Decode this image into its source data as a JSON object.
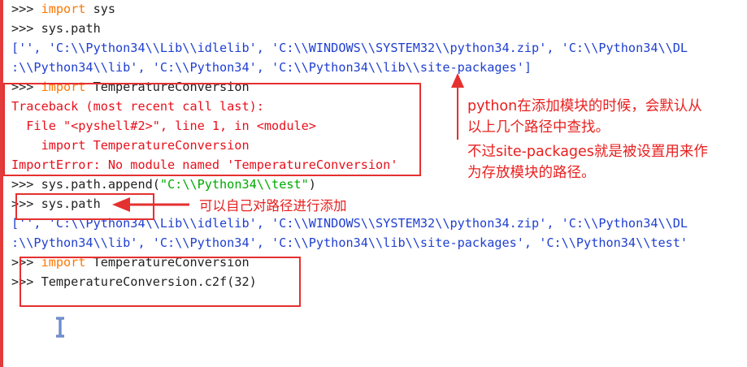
{
  "shell": {
    "lines": [
      {
        "prompt": ">>> ",
        "kw": "import",
        "code": " sys"
      },
      {
        "prompt": ">>> ",
        "code": "sys.path"
      },
      {
        "out": "['', 'C:\\\\Python34\\\\Lib\\\\idlelib', 'C:\\\\WINDOWS\\\\SYSTEM32\\\\python34.zip', 'C:\\\\Python34\\\\DL"
      },
      {
        "out": ":\\\\Python34\\\\lib', 'C:\\\\Python34', 'C:\\\\Python34\\\\lib\\\\site-packages']"
      },
      {
        "prompt": ">>> ",
        "kw": "import",
        "code": " TemperatureConversion"
      },
      {
        "err": "Traceback (most recent call last):"
      },
      {
        "err": "  File \"<pyshell#2>\", line 1, in <module>"
      },
      {
        "err": "    import TemperatureConversion"
      },
      {
        "err": "ImportError: No module named 'TemperatureConversion'"
      },
      {
        "prompt": ">>> ",
        "code": "sys.path.append(",
        "str": "\"C:\\\\Python34\\\\test\"",
        "code2": ")"
      },
      {
        "prompt": ">>> ",
        "code": "sys.path"
      },
      {
        "out": "['', 'C:\\\\Python34\\\\Lib\\\\idlelib', 'C:\\\\WINDOWS\\\\SYSTEM32\\\\python34.zip', 'C:\\\\Python34\\\\DL"
      },
      {
        "out": ":\\\\Python34\\\\lib', 'C:\\\\Python34', 'C:\\\\Python34\\\\lib\\\\site-packages', 'C:\\\\Python34\\\\test'"
      },
      {
        "prompt": ">>> ",
        "kw": "import",
        "code": " TemperatureConversion"
      },
      {
        "prompt": ">>> ",
        "code": "TemperatureConversion.c2f(32)"
      }
    ]
  },
  "annotations": {
    "note_search_line1": "python在添加模块的时候，会默认从",
    "note_search_line2": "以上几个路径中查找。",
    "note_site_line1": "不过site-packages就是被设置用来作",
    "note_site_line2": "为存放模块的路径。",
    "note_append": "可以自己对路径进行添加"
  },
  "colors": {
    "keyword": "#ff7700",
    "output": "#1f3fd0",
    "error": "#e8101b",
    "string": "#00aa00",
    "annotation": "#e53030"
  },
  "icons": {
    "cursor": "text-cursor-icon"
  }
}
